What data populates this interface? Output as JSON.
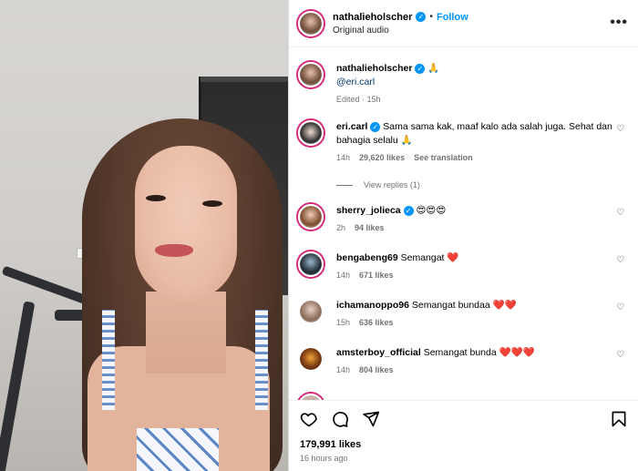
{
  "header": {
    "username": "nathalieholscher",
    "follow_label": "Follow",
    "separator": "•",
    "subtitle": "Original audio",
    "more_label": "•••"
  },
  "caption": {
    "username": "nathalieholscher",
    "emoji": "🙏",
    "mention": "@eri.carl",
    "edited": "Edited · 15h"
  },
  "comments": [
    {
      "username": "eri.carl",
      "text": "Sama sama kak, maaf kalo ada salah juga. Sehat dan bahagia selalu 🙏",
      "time": "14h",
      "likes": "29,620 likes",
      "extra": "See translation",
      "verified": true
    },
    {
      "username": "sherry_jolieca",
      "text": "😍😍😍",
      "time": "2h",
      "likes": "94 likes",
      "verified": true
    },
    {
      "username": "bengabeng69",
      "text": "Semangat ❤️",
      "time": "14h",
      "likes": "671 likes"
    },
    {
      "username": "ichamanoppo96",
      "text": "Semangat bundaa ❤️❤️",
      "time": "15h",
      "likes": "636 likes"
    },
    {
      "username": "amsterboy_official",
      "text": "Semangat bunda ❤️❤️❤️",
      "time": "14h",
      "likes": "804 likes"
    }
  ],
  "view_replies_label": "View replies (1)",
  "footer": {
    "likes_total": "179,991 likes",
    "posted": "16 hours ago"
  },
  "colors": {
    "accent": "#0095f6",
    "ring": "#d62976",
    "muted": "#737373"
  }
}
